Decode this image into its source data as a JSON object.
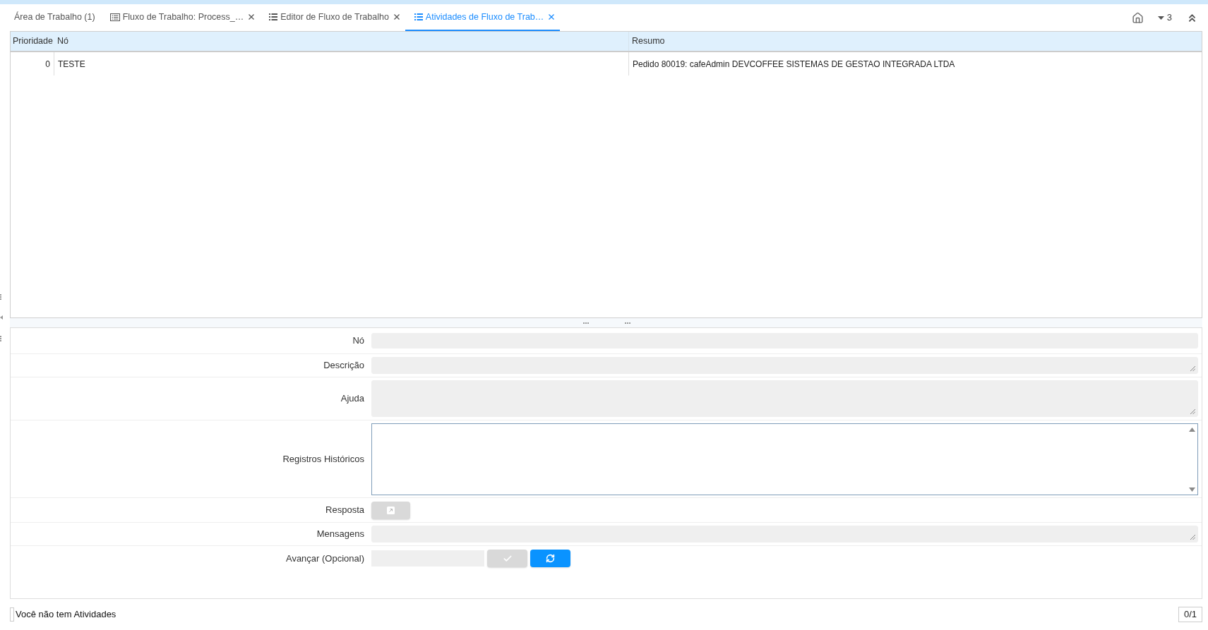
{
  "tabs": [
    {
      "label": "Área de Trabalho (1)",
      "kind": "plain",
      "closable": false,
      "selected": false
    },
    {
      "label": "Fluxo de Trabalho: Process_…",
      "kind": "form",
      "closable": true,
      "selected": false
    },
    {
      "label": "Editor de Fluxo de Trabalho",
      "kind": "list",
      "closable": true,
      "selected": false
    },
    {
      "label": "Atividades de Fluxo de Trab…",
      "kind": "list",
      "closable": true,
      "selected": true
    }
  ],
  "toolbar": {
    "tab_count": "3"
  },
  "table": {
    "columns": [
      "Prioridade",
      "Nó",
      "Resumo"
    ],
    "rows": [
      [
        "0",
        "TESTE",
        "Pedido 80019: cafeAdmin DEVCOFFEE SISTEMAS DE GESTAO INTEGRADA LTDA"
      ]
    ]
  },
  "form": {
    "fields": [
      {
        "label": "Nó",
        "kind": "input",
        "disabled": true
      },
      {
        "label": "Descrição",
        "kind": "textarea",
        "disabled": true
      },
      {
        "label": "Ajuda",
        "kind": "memo",
        "disabled": true
      },
      {
        "label": "Registros Históricos",
        "kind": "log",
        "disabled": false
      },
      {
        "label": "Resposta",
        "kind": "button",
        "disabled": true
      },
      {
        "label": "Mensagens",
        "kind": "textarea",
        "disabled": true
      },
      {
        "label": "Avançar (Opcional)",
        "kind": "advance",
        "disabled": true,
        "actions": [
          {
            "kind": "confirm",
            "disabled": true
          },
          {
            "kind": "refresh",
            "disabled": false
          }
        ]
      }
    ]
  },
  "status_bar": {
    "message": "Você não tem Atividades",
    "page": "0/1"
  }
}
